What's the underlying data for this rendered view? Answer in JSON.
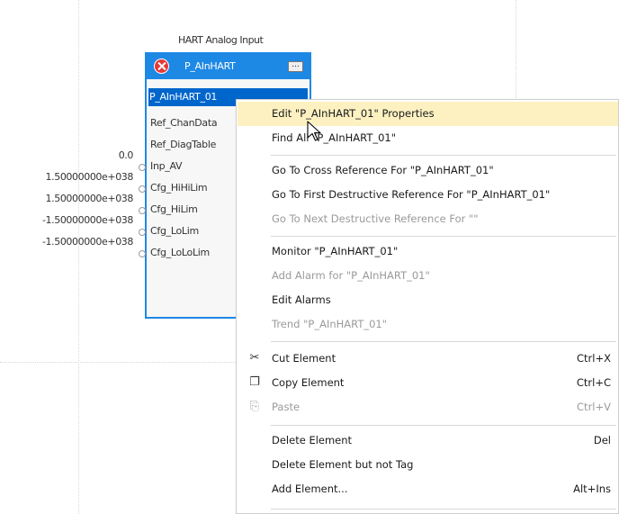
{
  "block": {
    "title": "HART Analog Input",
    "name": "P_AInHART",
    "tag": "P_AInHART_01",
    "error_icon": "error-x-icon",
    "more_button": "..."
  },
  "pins": {
    "ref_chan": "Ref_ChanData",
    "ref_diag": "Ref_DiagTable",
    "inp_av": "Inp_AV",
    "cfg_hihilim": "Cfg_HiHiLim",
    "cfg_hilim": "Cfg_HiLim",
    "cfg_lolim": "Cfg_LoLim",
    "cfg_lololim": "Cfg_LoLoLim"
  },
  "values": {
    "inp_av": "0.0",
    "cfg_hihilim": "1.50000000e+038",
    "cfg_hilim": "1.50000000e+038",
    "cfg_lolim": "-1.50000000e+038",
    "cfg_lololim": "-1.50000000e+038"
  },
  "menu": {
    "edit_props": "Edit \"P_AInHART_01\" Properties",
    "find_all": "Find All \"P_AInHART_01\"",
    "cross_ref": "Go To Cross Reference For \"P_AInHART_01\"",
    "first_destr": "Go To First Destructive Reference For \"P_AInHART_01\"",
    "next_destr": "Go To Next Destructive Reference For \"\"",
    "monitor": "Monitor \"P_AInHART_01\"",
    "add_alarm": "Add Alarm for \"P_AInHART_01\"",
    "edit_alarms": "Edit Alarms",
    "trend": "Trend \"P_AInHART_01\"",
    "cut": "Cut Element",
    "cut_sc": "Ctrl+X",
    "copy": "Copy Element",
    "copy_sc": "Ctrl+C",
    "paste": "Paste",
    "paste_sc": "Ctrl+V",
    "delete": "Delete Element",
    "delete_sc": "Del",
    "delete_keep_tag": "Delete Element but not Tag",
    "add_element": "Add Element...",
    "add_element_sc": "Alt+Ins"
  },
  "colors": {
    "block_accent": "#1e88e5",
    "hover_highlight": "#fdf1c1",
    "error_red": "#e53935"
  }
}
